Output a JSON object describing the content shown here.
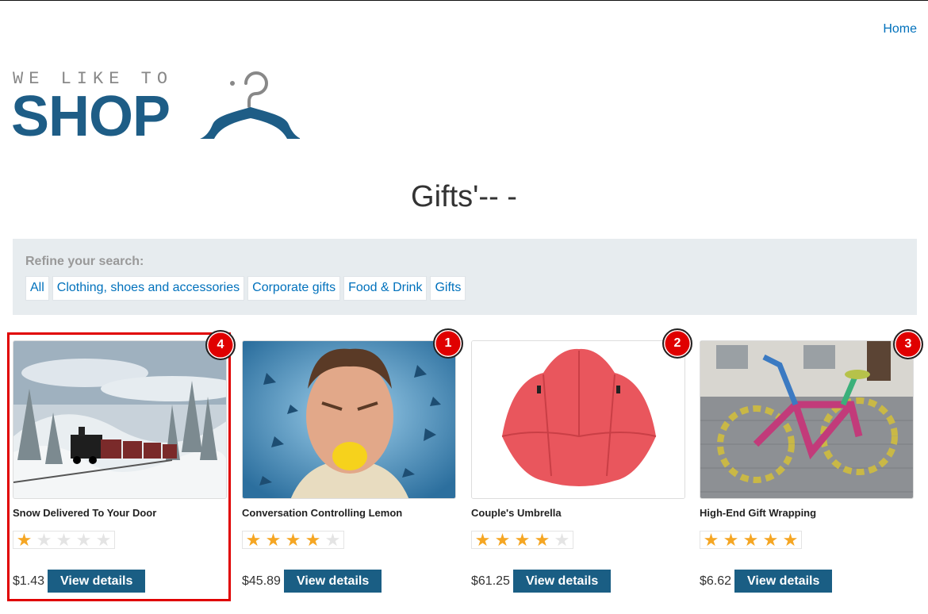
{
  "nav": {
    "home_label": "Home"
  },
  "logo": {
    "tagline": "WE LIKE TO",
    "wordmark": "SHOP"
  },
  "page": {
    "title": "Gifts'-- -"
  },
  "filters": {
    "label": "Refine your search:",
    "items": [
      "All",
      "Clothing, shoes and accessories",
      "Corporate gifts",
      "Food & Drink",
      "Gifts"
    ]
  },
  "products": [
    {
      "name": "Snow Delivered To Your Door",
      "rating": 1,
      "price": "$1.43",
      "button": "View details",
      "badge": "4",
      "image": "snowy-train"
    },
    {
      "name": "Conversation Controlling Lemon",
      "rating": 4,
      "price": "$45.89",
      "button": "View details",
      "badge": "1",
      "image": "man-with-lemon"
    },
    {
      "name": "Couple's Umbrella",
      "rating": 4,
      "price": "$61.25",
      "button": "View details",
      "badge": "2",
      "image": "red-umbrella"
    },
    {
      "name": "High-End Gift Wrapping",
      "rating": 5,
      "price": "$6.62",
      "button": "View details",
      "badge": "3",
      "image": "knitted-bicycle"
    }
  ],
  "colors": {
    "brand": "#1e5d86",
    "button": "#1a5e84",
    "link": "#0071bc",
    "star": "#f5a623",
    "badge": "#e00000"
  }
}
